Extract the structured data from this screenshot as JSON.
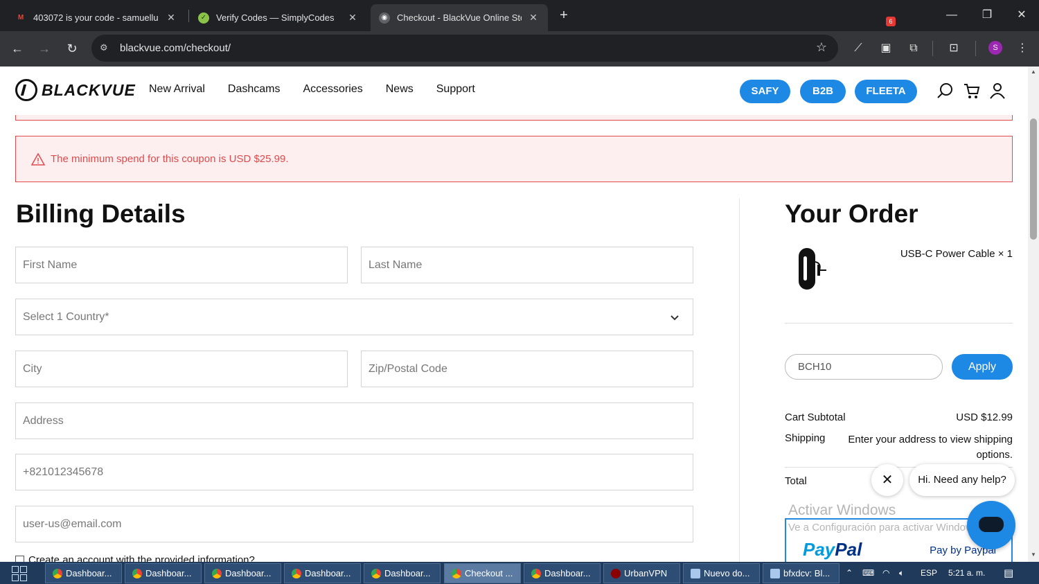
{
  "browser": {
    "tabs": [
      {
        "title": "403072 is your code - samuellu",
        "icon": "gmail-icon",
        "active": false
      },
      {
        "title": "Verify Codes — SimplyCodes",
        "icon": "simplycodes-icon",
        "active": false
      },
      {
        "title": "Checkout - BlackVue Online Sto",
        "icon": "blackvue-icon",
        "active": true
      }
    ],
    "url": "blackvue.com/checkout/",
    "extension_badge": "6",
    "profile_initial": "S"
  },
  "header": {
    "logo_text": "BLACKVUE",
    "nav": [
      "New Arrival",
      "Dashcams",
      "Accessories",
      "News",
      "Support"
    ],
    "pills": [
      "SAFY",
      "B2B",
      "FLEETA"
    ]
  },
  "alert": {
    "message": "The minimum spend for this coupon is USD $25.99."
  },
  "billing": {
    "title": "Billing Details",
    "first_name_placeholder": "First Name",
    "last_name_placeholder": "Last Name",
    "country_placeholder": "Select 1 Country*",
    "city_placeholder": "City",
    "zip_placeholder": "Zip/Postal Code",
    "address_placeholder": "Address",
    "phone_value": "+821012345678",
    "email_value": "user-us@email.com",
    "create_account_label": "Create an account with the provided information?"
  },
  "order": {
    "title": "Your Order",
    "product": "USB-C Power Cable × 1",
    "coupon_value": "BCH10",
    "apply_label": "Apply",
    "subtotal_label": "Cart Subtotal",
    "subtotal_value": "USD $12.99",
    "shipping_label": "Shipping",
    "shipping_value": "Enter your address to view shipping options.",
    "total_label": "Total",
    "paypal_logo_pay": "Pay",
    "paypal_logo_pal": "Pal",
    "paypal_by": "Pay by Paypal"
  },
  "watermark": {
    "title": "Activar Windows",
    "subtitle": "Ve a Configuración para activar Windows."
  },
  "chat": {
    "greeting": "Hi. Need any help?"
  },
  "taskbar": {
    "items": [
      {
        "label": "Dashboar...",
        "active": false
      },
      {
        "label": "Dashboar...",
        "active": false
      },
      {
        "label": "Dashboar...",
        "active": false
      },
      {
        "label": "Dashboar...",
        "active": false
      },
      {
        "label": "Dashboar...",
        "active": false
      },
      {
        "label": "Checkout ...",
        "active": true
      },
      {
        "label": "Dashboar...",
        "active": false
      },
      {
        "label": "UrbanVPN",
        "active": false
      },
      {
        "label": "Nuevo do...",
        "active": false
      },
      {
        "label": "bfxdcv: Bl...",
        "active": false
      }
    ],
    "language": "ESP",
    "time": "5:21 a. m."
  },
  "colors": {
    "accent": "#1e88e5",
    "error": "#e04a4a",
    "chrome_dark": "#202124",
    "taskbar": "#1f3a5a"
  }
}
